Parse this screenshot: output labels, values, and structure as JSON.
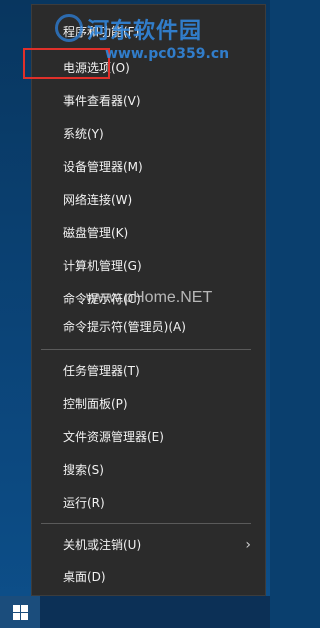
{
  "menu": {
    "items": [
      {
        "label": "程序和功能(F)"
      },
      {
        "label": "电源选项(O)"
      },
      {
        "label": "事件查看器(V)"
      },
      {
        "label": "系统(Y)"
      },
      {
        "label": "设备管理器(M)"
      },
      {
        "label": "网络连接(W)"
      },
      {
        "label": "磁盘管理(K)"
      },
      {
        "label": "计算机管理(G)"
      },
      {
        "label": "命令提示符(C)"
      },
      {
        "label": "命令提示符(管理员)(A)"
      },
      {
        "label": "任务管理器(T)"
      },
      {
        "label": "控制面板(P)"
      },
      {
        "label": "文件资源管理器(E)"
      },
      {
        "label": "搜索(S)"
      },
      {
        "label": "运行(R)"
      },
      {
        "label": "关机或注销(U)",
        "submenu_icon": "chevron-right-icon",
        "submenu_glyph": "›"
      },
      {
        "label": "桌面(D)"
      }
    ],
    "highlighted_item": "电源选项(O)"
  },
  "watermarks": {
    "top_title": "河东软件园",
    "top_url": "www.pc0359.cn",
    "middle": "www.pHome.NET"
  },
  "taskbar": {
    "start_icon": "windows-logo-icon"
  },
  "colors": {
    "menu_bg": "#2b2b2b",
    "menu_text": "#f2f2f2",
    "separator": "#5a5a5a",
    "highlight_border": "#e0302a",
    "desktop": "#0b4478",
    "taskbar": "#0c3056"
  }
}
